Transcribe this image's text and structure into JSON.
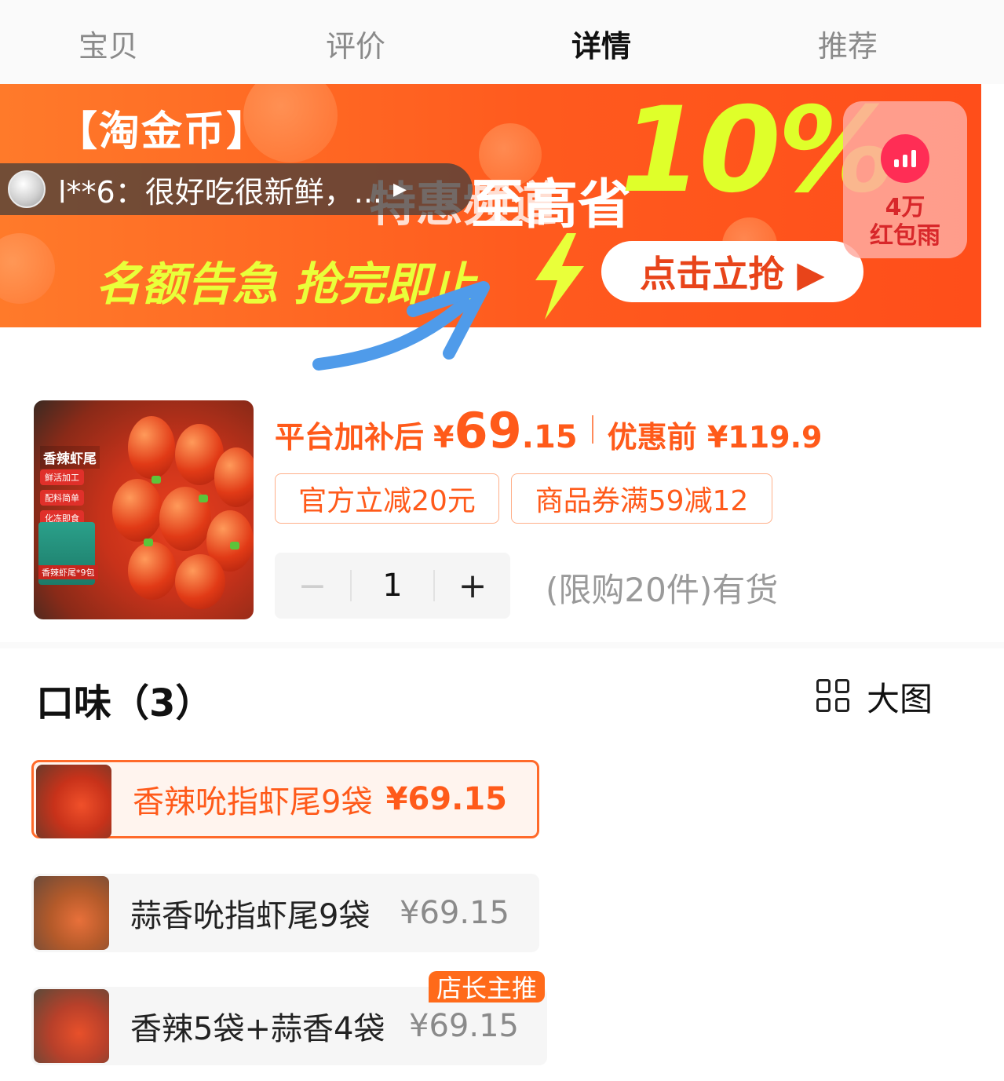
{
  "tabs": [
    "宝贝",
    "评价",
    "详情",
    "推荐"
  ],
  "banner": {
    "title": "【淘金币】",
    "hidden_text": "特惠频道",
    "save_text": "至高省",
    "percent": "10%",
    "urgent": "名额告急 抢完即止",
    "cta": "点击立抢 ▶",
    "review": "l**6：很好吃很新鲜，...",
    "red_rain_line1": "4万",
    "red_rain_line2": "红包雨"
  },
  "product": {
    "thumb_label": "香辣虾尾",
    "thumb_bullets": [
      "鲜活加工",
      "配料简单",
      "化冻即食"
    ],
    "thumb_foot": "香辣虾尾*9包",
    "price_prefix": "平台加补后",
    "price_yen": "¥",
    "price_int": "69",
    "price_dec": ".15",
    "orig_price": "优惠前 ¥119.9",
    "tags": [
      "官方立减20元",
      "商品券满59减12"
    ],
    "qty_minus": "−",
    "qty_value": "1",
    "qty_plus": "+",
    "stock": "(限购20件)有货"
  },
  "flavor": {
    "title": "口味（3）",
    "bigview_label": "大图",
    "options": [
      {
        "name": "香辣吮指虾尾9袋",
        "price": "¥69.15"
      },
      {
        "name": "蒜香吮指虾尾9袋",
        "price": "¥69.15"
      },
      {
        "name": "香辣5袋+蒜香4袋",
        "price": "¥69.15"
      }
    ],
    "badge": "店长主推"
  },
  "colors": {
    "accent": "#ff5a1a",
    "banner": "#ff5a1e",
    "lime": "#dfff2a",
    "annotation_arrow": "#4f9bea"
  },
  "icons": [
    "avatar-icon",
    "play-arrow-icon",
    "bar-chart-icon",
    "lightning-icon",
    "grid-icon"
  ]
}
